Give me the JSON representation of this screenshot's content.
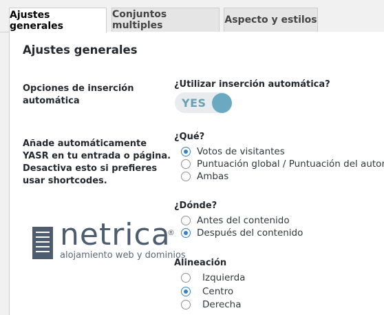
{
  "tabs": [
    {
      "label": "Ajustes generales",
      "active": true
    },
    {
      "label": "Conjuntos multiples",
      "active": false
    },
    {
      "label": "Aspecto y estilos",
      "active": false
    }
  ],
  "section_title": "Ajustes generales",
  "auto_insert": {
    "label_line1": "Opciones de inserción",
    "label_line2": "automática",
    "question": "¿Utilizar inserción automática?",
    "toggle_text": "YES",
    "toggle_on": true
  },
  "description": {
    "line1": "Añade automáticamente",
    "line2": "YASR en tu entrada o página.",
    "line3": "Desactiva esto si prefieres",
    "line4": "usar shortcodes."
  },
  "what": {
    "question": "¿Qué?",
    "options": [
      {
        "label": "Votos de visitantes",
        "checked": true
      },
      {
        "label": "Puntuación global / Puntuación del autor",
        "checked": false
      },
      {
        "label": "Ambas",
        "checked": false
      }
    ]
  },
  "where": {
    "question": "¿Dónde?",
    "options": [
      {
        "label": "Antes del contenido",
        "checked": false
      },
      {
        "label": "Después del contenido",
        "checked": true
      }
    ]
  },
  "alignment": {
    "question": "Alineación",
    "options": [
      {
        "label": "Izquierda",
        "checked": false
      },
      {
        "label": "Centro",
        "checked": true
      },
      {
        "label": "Derecha",
        "checked": false
      }
    ]
  },
  "watermark": {
    "brand": "netrica",
    "registered": "®",
    "tagline": "alojamiento web y dominios"
  },
  "colors": {
    "accent": "#3582c4",
    "toggle_knob": "#6aa9c0",
    "toggle_text": "#6a9fb0",
    "watermark": "#2e4055"
  }
}
